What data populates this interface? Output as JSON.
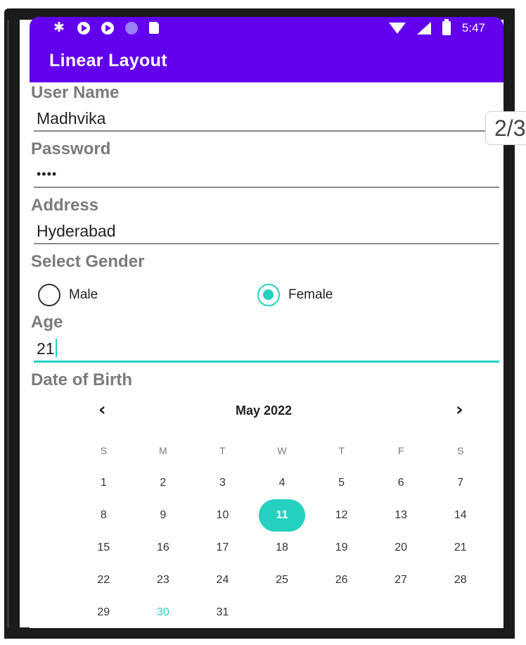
{
  "status_bar": {
    "left_icons": [
      "settings-icon",
      "play-protect-icon",
      "play-protect-icon",
      "notification-dot-icon",
      "sd-card-icon"
    ],
    "right_icons": [
      "wifi-icon",
      "signal-icon",
      "battery-icon"
    ],
    "time": "5:47"
  },
  "app_bar": {
    "title": "Linear Layout"
  },
  "form": {
    "username": {
      "label": "User Name",
      "value": "Madhvika"
    },
    "password": {
      "label": "Password",
      "value": "••••"
    },
    "address": {
      "label": "Address",
      "value": "Hyderabad"
    },
    "gender": {
      "label": "Select Gender",
      "options": [
        {
          "label": "Male",
          "checked": false
        },
        {
          "label": "Female",
          "checked": true
        }
      ]
    },
    "age": {
      "label": "Age",
      "value": "21"
    },
    "dob": {
      "label": "Date of Birth"
    }
  },
  "calendar": {
    "month_label": "May 2022",
    "prev_glyph": "‹",
    "next_glyph": "›",
    "weekdays": [
      "S",
      "M",
      "T",
      "W",
      "T",
      "F",
      "S"
    ],
    "weeks": [
      [
        "1",
        "2",
        "3",
        "4",
        "5",
        "6",
        "7"
      ],
      [
        "8",
        "9",
        "10",
        "11",
        "12",
        "13",
        "14"
      ],
      [
        "15",
        "16",
        "17",
        "18",
        "19",
        "20",
        "21"
      ],
      [
        "22",
        "23",
        "24",
        "25",
        "26",
        "27",
        "28"
      ],
      [
        "29",
        "30",
        "31",
        "",
        "",
        "",
        ""
      ]
    ],
    "selected_day": "11",
    "today": "30"
  },
  "page_indicator": "2/3",
  "colors": {
    "primary": "#6200ee",
    "accent": "#26d0c0"
  }
}
